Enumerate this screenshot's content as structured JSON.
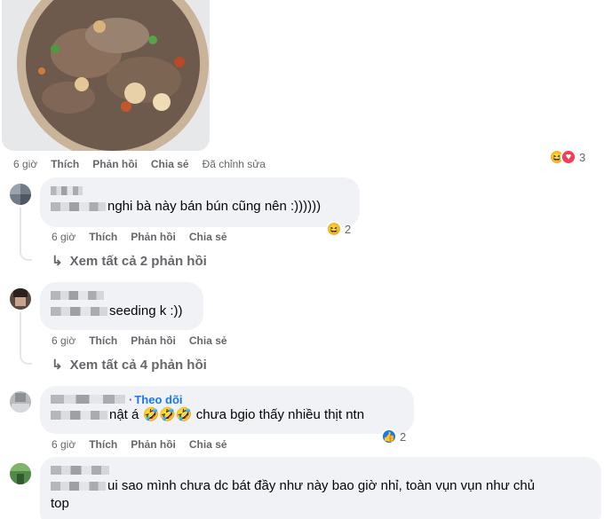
{
  "post": {
    "image_alt": "bowl of noodles with beef",
    "meta": {
      "time": "6 giờ",
      "like": "Thích",
      "reply": "Phản hồi",
      "share": "Chia sẻ",
      "edited": "Đã chỉnh sửa"
    },
    "reactions": {
      "icons": [
        "haha-icon",
        "heart-icon"
      ],
      "count": "3"
    }
  },
  "comments": [
    {
      "text": "nghi bà này bán bún cũng nên :))))))",
      "meta": {
        "time": "6 giờ",
        "like": "Thích",
        "reply": "Phản hồi",
        "share": "Chia sẻ"
      },
      "reactions": {
        "icons": [
          "haha-icon"
        ],
        "count": "2"
      },
      "see_replies": "Xem tất cả 2 phản hồi"
    },
    {
      "text": "seeding k :))",
      "meta": {
        "time": "6 giờ",
        "like": "Thích",
        "reply": "Phản hồi",
        "share": "Chia sẻ"
      },
      "see_replies": "Xem tất cả 4 phản hồi"
    },
    {
      "follow": "Theo dõi",
      "dot": "·",
      "text": "nật á 🤣🤣🤣 chưa bgio thấy nhiều thịt ntn",
      "meta": {
        "time": "6 giờ",
        "like": "Thích",
        "reply": "Phản hồi",
        "share": "Chia sẻ"
      },
      "reactions": {
        "icons": [
          "like-icon"
        ],
        "count": "2"
      }
    },
    {
      "text_line1": "ui sao mình chưa dc bát đầy như này bao giờ nhỉ, toàn vụn vụn như chủ",
      "text_line2": "top"
    }
  ],
  "colors": {
    "bubble": "#f0f2f5",
    "meta": "#65676b",
    "link": "#1877f2",
    "like": "#1877f2",
    "haha": "#f7b928",
    "heart": "#f33e58"
  }
}
